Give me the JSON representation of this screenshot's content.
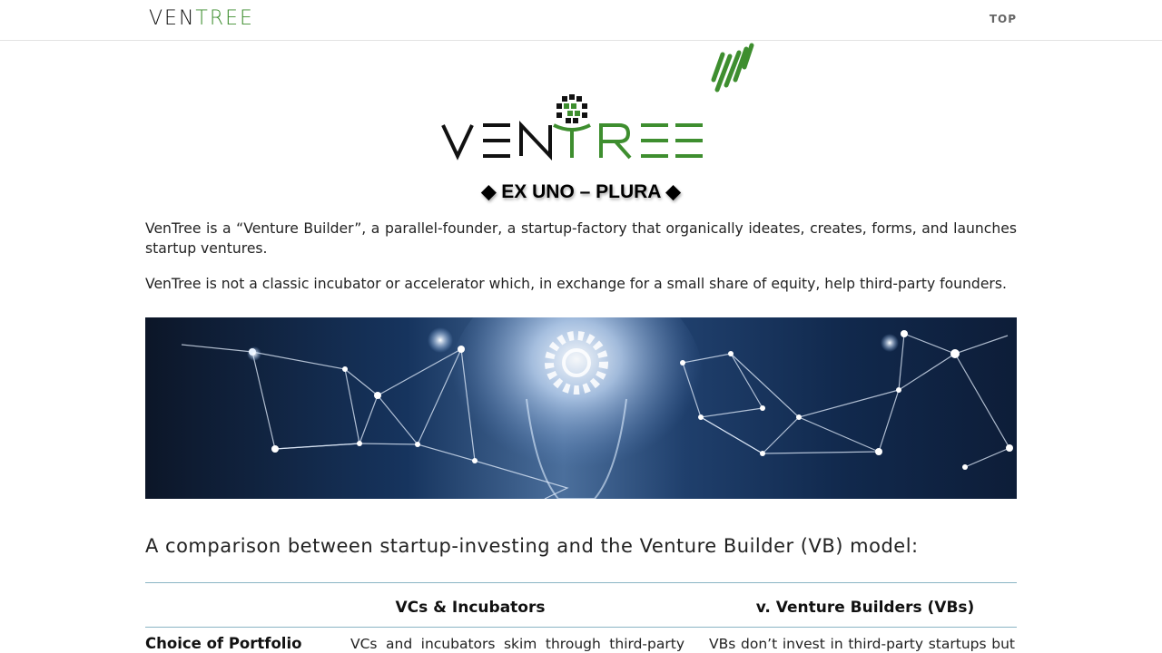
{
  "nav": {
    "brand_ven": "VEN",
    "brand_tree": "TREE",
    "top_label": "TOP"
  },
  "hero": {
    "tagline": "◆ EX UNO – PLURA ◆"
  },
  "intro": {
    "p1": "VenTree is a “Venture Builder”, a parallel-founder, a startup-factory that organically ideates, creates, forms, and launches startup ventures.",
    "p2": "VenTree is not a classic incubator or accelerator which, in exchange for a small share of equity, help third-party founders."
  },
  "comparison": {
    "title": "A comparison between startup-investing and the Venture Builder (VB) model:",
    "col_vc": "VCs & Incubators",
    "col_vb": "v. Venture Builders (VBs)",
    "rows": [
      {
        "label": "Choice of Portfolio",
        "vc": "VCs and incubators skim through third-party pitch",
        "vb": "VBs don’t invest in third-party startups but"
      }
    ]
  },
  "colors": {
    "brand_green": "#3e8e2f",
    "rule": "#8ab4c4"
  }
}
